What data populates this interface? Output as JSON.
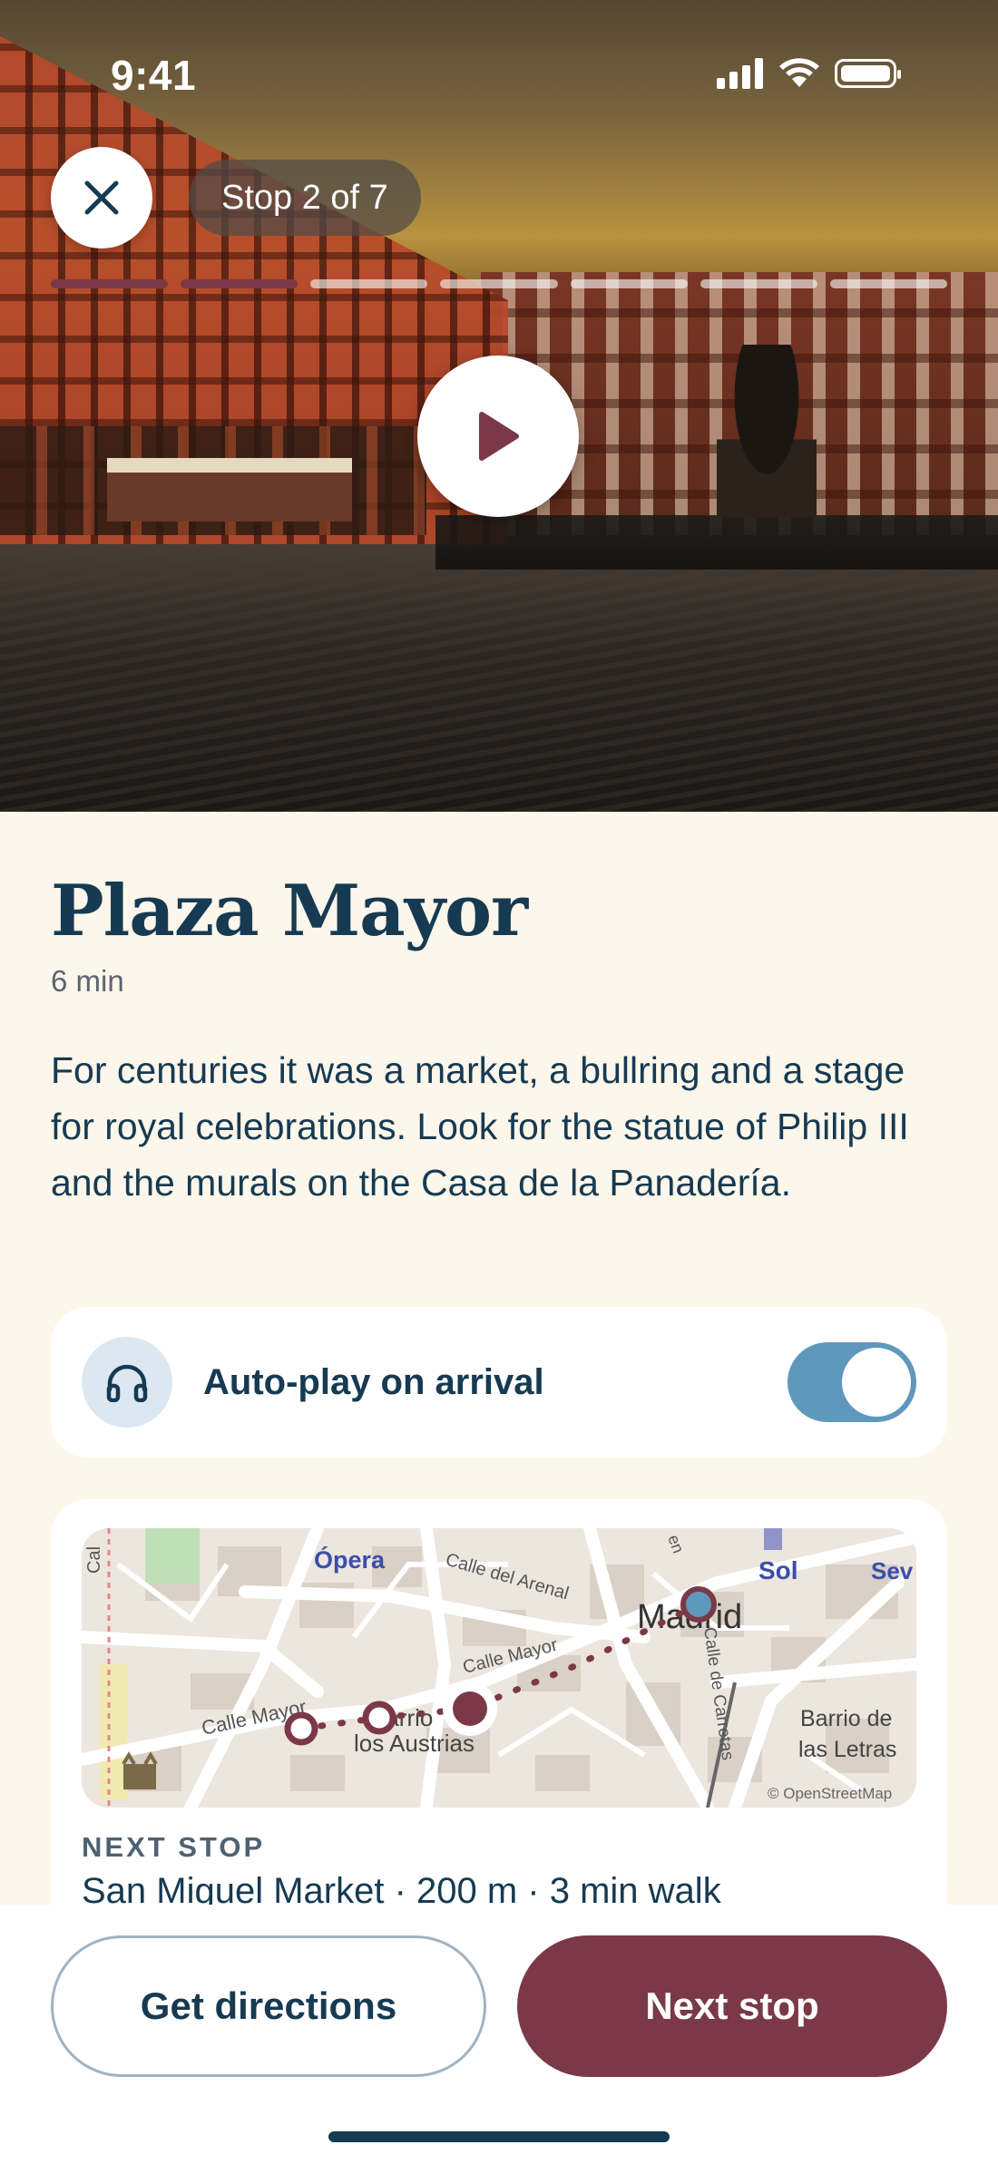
{
  "status_bar": {
    "time": "9:41"
  },
  "header": {
    "stop_label": "Stop 2 of 7",
    "progress": {
      "current": 2,
      "total": 7
    }
  },
  "stop": {
    "title": "Plaza Mayor",
    "duration": "6 min",
    "description": "For centuries it was a market, a bullring and a stage for royal celebrations. Look for the statue of Philip III and the murals on the Casa de la Panadería."
  },
  "autoplay": {
    "label": "Auto-play on arrival",
    "enabled": true
  },
  "map": {
    "labels": {
      "opera": "Ópera",
      "calle_arenal": "Calle del Arenal",
      "madrid": "Madrid",
      "sol": "Sol",
      "sev": "Sev",
      "calle_mayor_1": "Calle Mayor",
      "calle_mayor_2": "Calle Mayor",
      "barrio_austrias_1": "Barrio",
      "barrio_austrias_2": "los Austrias",
      "calle_carretas": "Calle de Carretas",
      "barrio_letras_1": "Barrio de",
      "barrio_letras_2": "las Letras",
      "attribution": "© OpenStreetMap",
      "cal": "Cal",
      "en": "en"
    }
  },
  "next_stop": {
    "label": "NEXT STOP",
    "value": "San Miguel Market · 200 m · 3 min walk"
  },
  "actions": {
    "directions": "Get directions",
    "next": "Next stop"
  },
  "colors": {
    "accent": "#7b3948",
    "navy": "#163a52",
    "toggle": "#5e98bc",
    "background": "#fdf6ea"
  }
}
